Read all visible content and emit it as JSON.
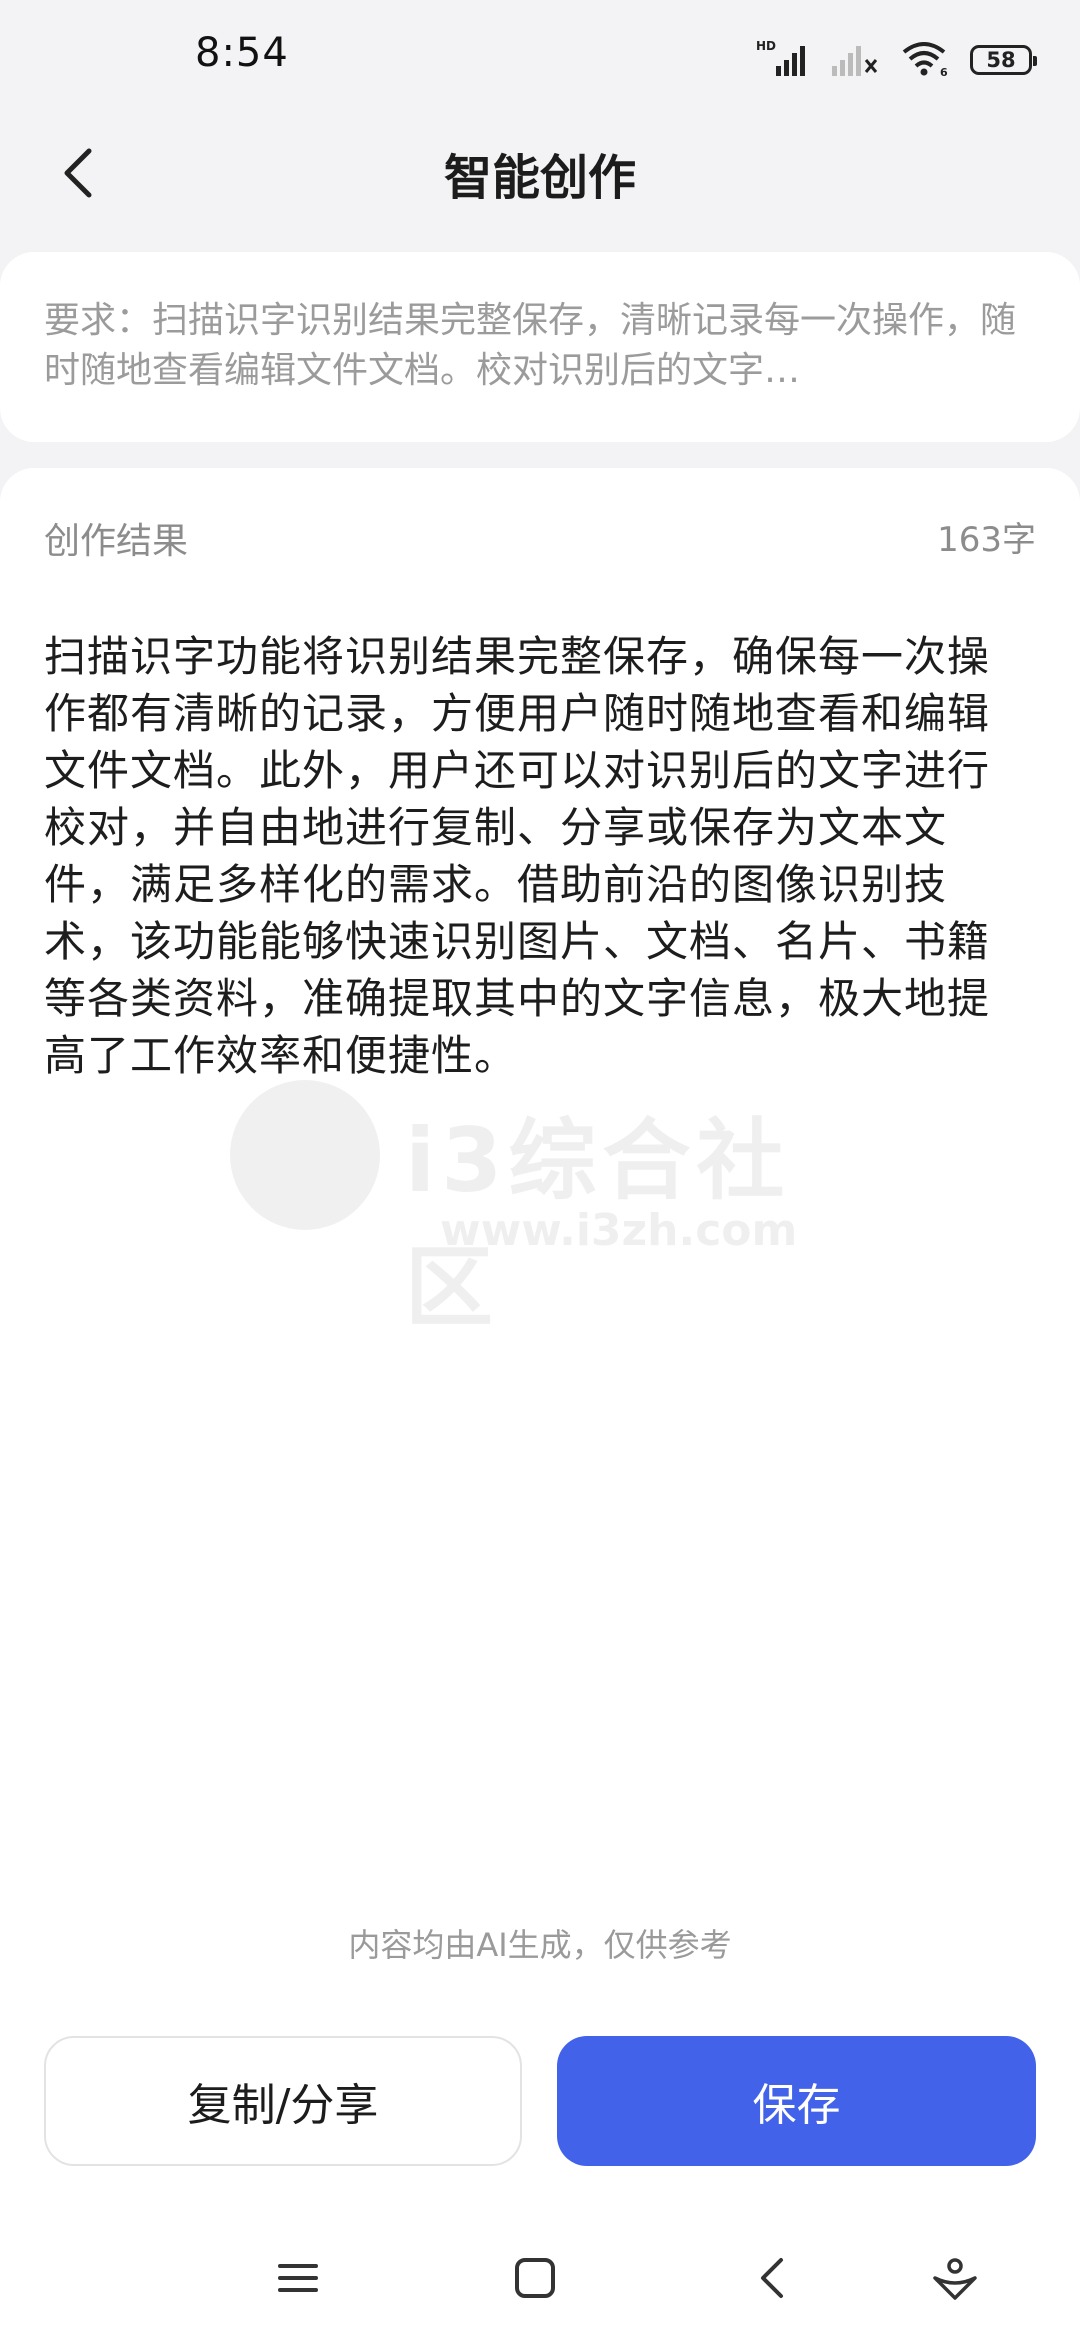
{
  "status_bar": {
    "time": "8:54",
    "battery": "58",
    "icons": [
      "hd-signal-icon",
      "no-signal-icon",
      "wifi-icon",
      "battery-icon"
    ]
  },
  "header": {
    "title": "智能创作",
    "back_icon": "chevron-left-icon"
  },
  "requirement": {
    "text": "要求：扫描识字识别结果完整保存，清晰记录每一次操作，随时随地查看编辑文件文档。校对识别后的文字…"
  },
  "result": {
    "label": "创作结果",
    "word_count": "163字",
    "text": "扫描识字功能将识别结果完整保存，确保每一次操作都有清晰的记录，方便用户随时随地查看和编辑文件文档。此外，用户还可以对识别后的文字进行校对，并自由地进行复制、分享或保存为文本文件，满足多样化的需求。借助前沿的图像识别技术，该功能能够快速识别图片、文档、名片、书籍等各类资料，准确提取其中的文字信息，极大地提高了工作效率和便捷性。"
  },
  "watermark": {
    "text": "i3综合社区",
    "url": "www.i3zh.com"
  },
  "disclaimer": "内容均由AI生成，仅供参考",
  "actions": {
    "copy_share_label": "复制/分享",
    "save_label": "保存"
  },
  "colors": {
    "accent": "#4262ea",
    "background": "#f3f3f5",
    "card": "#ffffff",
    "muted_text": "#9b9b9b"
  },
  "nav_bar": {
    "icons": [
      "menu-icon",
      "home-square-icon",
      "back-icon",
      "assistant-icon"
    ]
  }
}
